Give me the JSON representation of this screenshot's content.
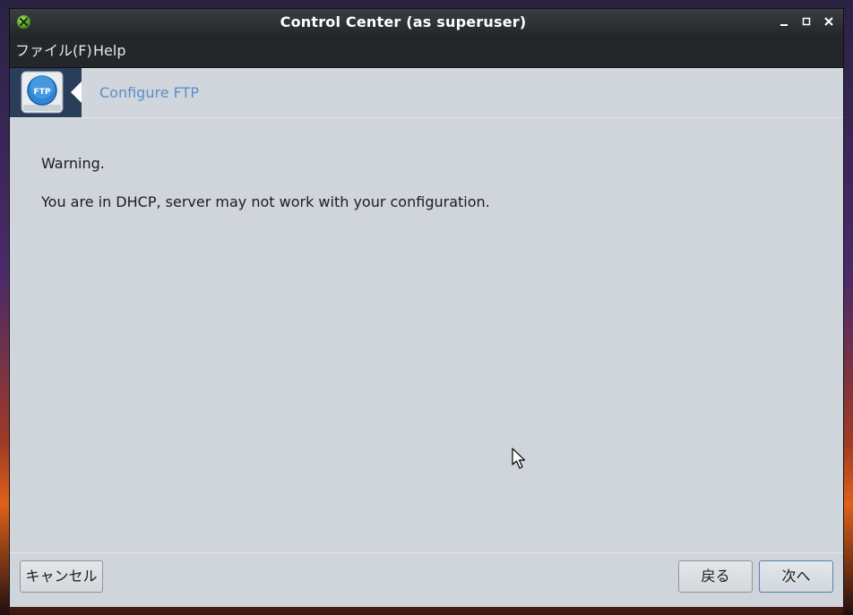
{
  "window": {
    "title": "Control Center (as superuser)",
    "controls": {
      "minimize": "▁",
      "maximize": "▫",
      "close": "✕"
    }
  },
  "menubar": {
    "file_label": "ファイル(F)",
    "help_label": "Help"
  },
  "header": {
    "icon": "ftp-folder-icon",
    "icon_text": "FTP",
    "title": "Configure FTP"
  },
  "content": {
    "warning_title": "Warning.",
    "warning_message": "You are in DHCP, server may not work with your configuration."
  },
  "footer": {
    "cancel_label": "キャンセル",
    "back_label": "戻る",
    "next_label": "次へ"
  },
  "colors": {
    "accent": "#5b8dc9",
    "header_icon_bg": "#2a3d5b",
    "titlebar_bg": "#25282b",
    "window_bg": "#cfd5da"
  }
}
